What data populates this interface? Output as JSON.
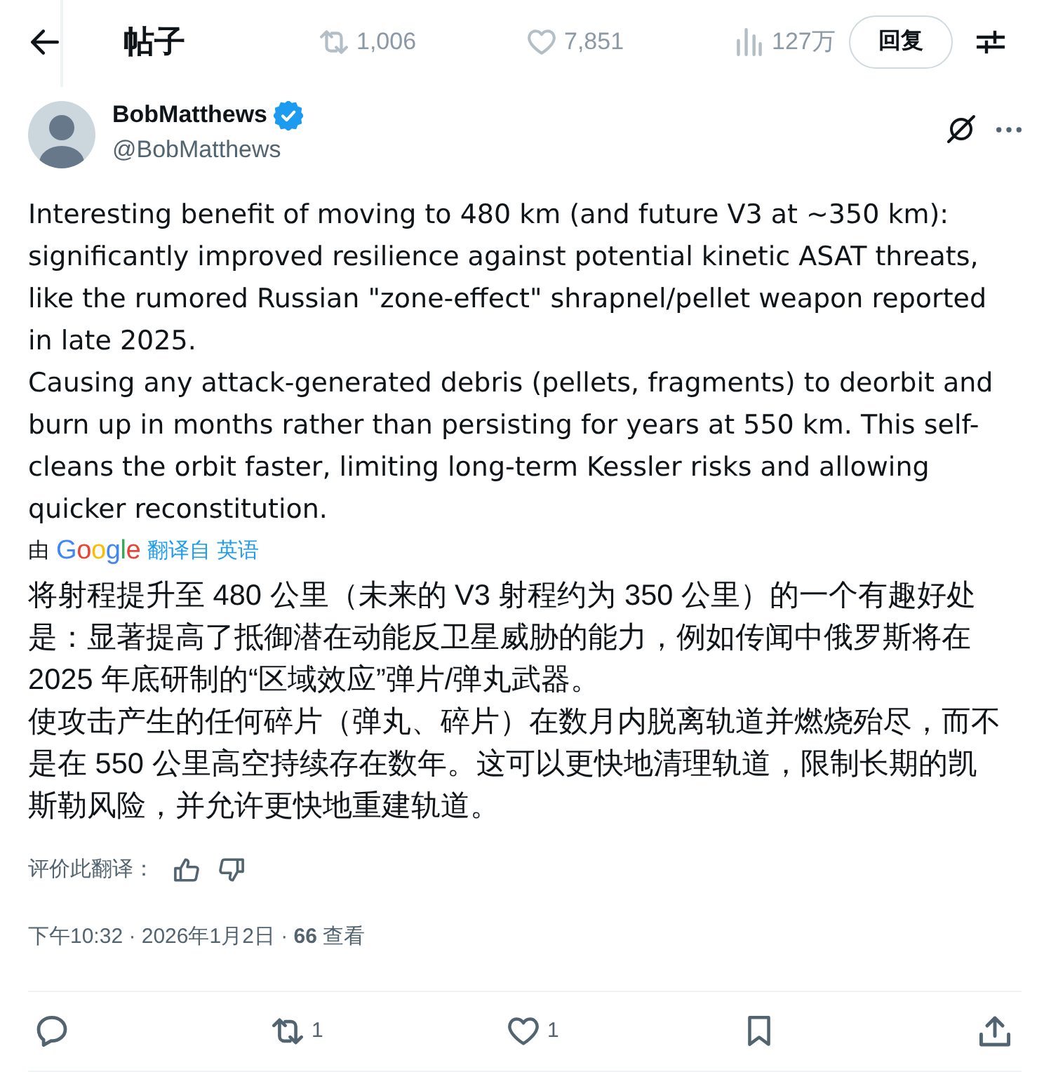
{
  "header": {
    "title": "帖子",
    "reply_button": "回复",
    "background_stats": [
      {
        "kind": "retweet",
        "count": "1,006"
      },
      {
        "kind": "like",
        "count": "7,851"
      },
      {
        "kind": "views",
        "count": "127万"
      }
    ]
  },
  "author": {
    "name": "BobMatthews",
    "verified": true,
    "handle": "@BobMatthews"
  },
  "post": {
    "text": [
      "Interesting benefit of moving to 480 km (and future V3 at ~350 km): significantly improved resilience against potential kinetic ASAT threats, like the rumored Russian \"zone-effect\" shrapnel/pellet weapon reported in late 2025.",
      "Causing any attack-generated debris (pellets, fragments) to deorbit and burn up in months rather than persisting for years at 550 km. This self-cleans the orbit faster, limiting long-term Kessler risks and allowing quicker reconstitution."
    ],
    "translation_note": {
      "prefix": "由",
      "provider": "Google",
      "link": "翻译自 英语"
    },
    "translation": [
      "将射程提升至 480 公里（未来的 V3 射程约为 350 公里）的一个有趣好处是：显著提高了抵御潜在动能反卫星威胁的能力，例如传闻中俄罗斯将在 2025 年底研制的“区域效应”弹片/弹丸武器。",
      "使攻击产生的任何碎片（弹丸、碎片）在数月内脱离轨道并燃烧殆尽，而不是在 550 公里高空持续存在数年。这可以更快地清理轨道，限制长期的凯斯勒风险，并允许更快地重建轨道。"
    ],
    "rate_label": "评价此翻译：",
    "timestamp": "下午10:32 · 2026年1月2日 · **66** 查看"
  },
  "actions": [
    {
      "kind": "reply"
    },
    {
      "kind": "retweet",
      "count": "1"
    },
    {
      "kind": "like",
      "count": "1"
    },
    {
      "kind": "bookmark"
    },
    {
      "kind": "share"
    }
  ]
}
